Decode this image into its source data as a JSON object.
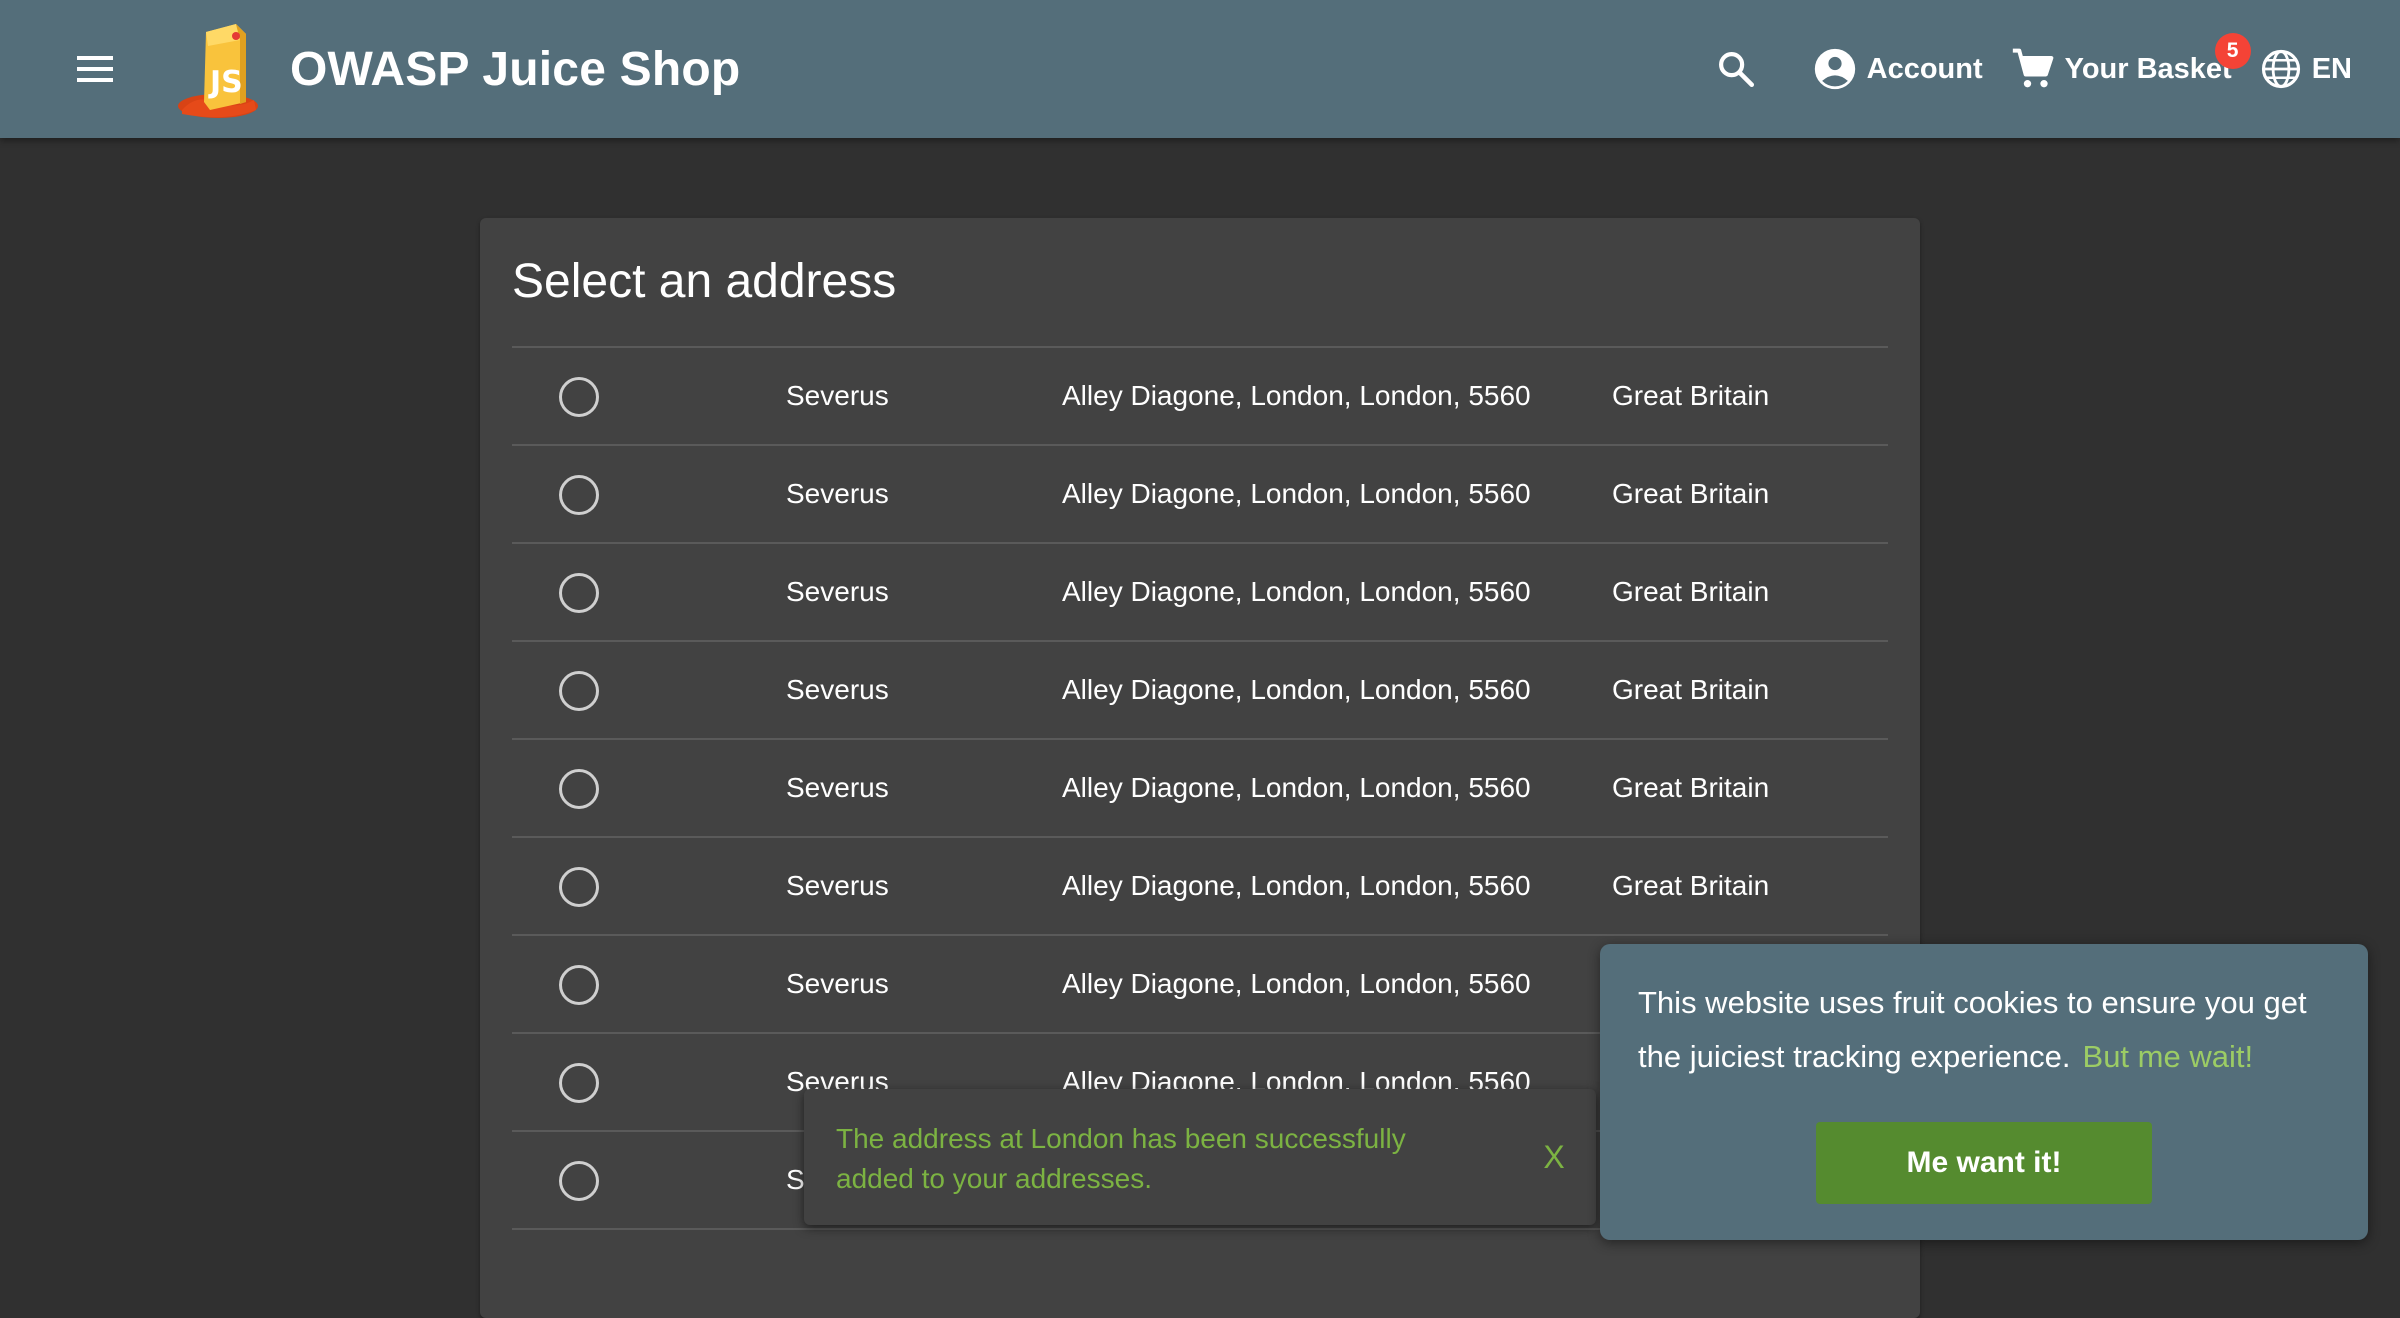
{
  "toolbar": {
    "menu_icon": "hamburger-menu-icon",
    "logo_icon": "juice-shop-logo",
    "title": "OWASP Juice Shop",
    "search_icon": "search-icon",
    "account_label": "Account",
    "account_icon": "account-circle-icon",
    "basket_label": "Your Basket",
    "basket_icon": "shopping-cart-icon",
    "basket_count": "5",
    "language_label": "EN",
    "language_icon": "globe-icon"
  },
  "address_card": {
    "title": "Select an address",
    "rows": [
      {
        "name": "Severus",
        "address": "Alley Diagone, London, London, 5560",
        "country": "Great Britain"
      },
      {
        "name": "Severus",
        "address": "Alley Diagone, London, London, 5560",
        "country": "Great Britain"
      },
      {
        "name": "Severus",
        "address": "Alley Diagone, London, London, 5560",
        "country": "Great Britain"
      },
      {
        "name": "Severus",
        "address": "Alley Diagone, London, London, 5560",
        "country": "Great Britain"
      },
      {
        "name": "Severus",
        "address": "Alley Diagone, London, London, 5560",
        "country": "Great Britain"
      },
      {
        "name": "Severus",
        "address": "Alley Diagone, London, London, 5560",
        "country": "Great Britain"
      },
      {
        "name": "Severus",
        "address": "Alley Diagone, London, London, 5560",
        "country": ""
      },
      {
        "name": "Severus",
        "address": "Alley Diagone, London, London, 5560",
        "country": ""
      },
      {
        "name": "S",
        "address": "",
        "country": ""
      }
    ]
  },
  "snackbar": {
    "message": "The address at London has been successfully added to your addresses.",
    "close_label": "X"
  },
  "cookie_banner": {
    "message": "This website uses fruit cookies to ensure you get the juiciest tracking experience.",
    "link_label": "But me wait!",
    "accept_label": "Me want it!"
  },
  "colors": {
    "toolbar": "#546e7a",
    "background": "#303030",
    "card": "#424242",
    "accent_green": "#558b2f",
    "success_text": "#7cb342",
    "badge": "#f44336"
  }
}
